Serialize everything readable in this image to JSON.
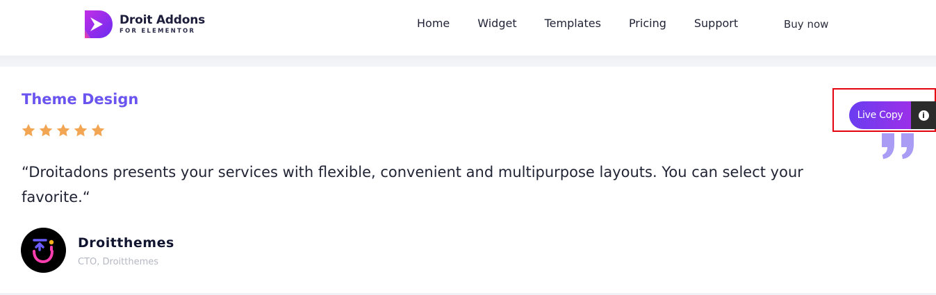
{
  "brand": {
    "title": "Droit Addons",
    "subtitle": "FOR ELEMENTOR"
  },
  "nav": {
    "items": [
      {
        "label": "Home"
      },
      {
        "label": "Widget"
      },
      {
        "label": "Templates"
      },
      {
        "label": "Pricing"
      },
      {
        "label": "Support"
      }
    ],
    "buy_now": "Buy now"
  },
  "testimonial": {
    "title": "Theme Design",
    "rating": 5,
    "rating_max": 5,
    "star_color": "#f2a654",
    "quote": "“Droitadons presents your services with flexible, convenient and multipurpose layouts. You can select your favorite.“",
    "author_name": "Droitthemes",
    "author_role": "CTO, Droitthemes",
    "accent_color": "#6a55f0"
  },
  "live_copy": {
    "label": "Live Copy",
    "info_icon": "info-icon",
    "highlight_color": "#e3000f"
  }
}
